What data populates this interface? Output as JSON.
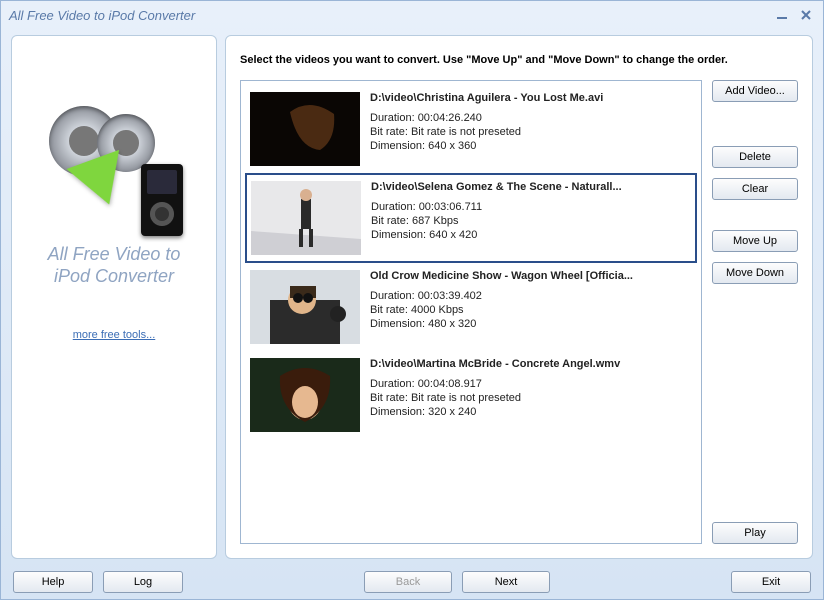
{
  "window": {
    "title": "All Free Video to iPod Converter"
  },
  "sidebar": {
    "appName1": "All Free Video to",
    "appName2": "iPod Converter",
    "moreTools": "more free tools..."
  },
  "main": {
    "instruction": "Select the videos you want to convert. Use \"Move Up\" and \"Move Down\" to change the order.",
    "videos": [
      {
        "title": "D:\\video\\Christina Aguilera - You Lost Me.avi",
        "duration": "Duration: 00:04:26.240",
        "bitrate": "Bit rate: Bit rate is not preseted",
        "dimension": "Dimension: 640 x 360",
        "selected": false
      },
      {
        "title": "D:\\video\\Selena Gomez & The Scene - Naturall...",
        "duration": "Duration: 00:03:06.711",
        "bitrate": "Bit rate: 687 Kbps",
        "dimension": "Dimension: 640 x 420",
        "selected": true
      },
      {
        "title": "Old Crow Medicine Show - Wagon Wheel [Officia...",
        "duration": "Duration: 00:03:39.402",
        "bitrate": "Bit rate: 4000 Kbps",
        "dimension": "Dimension: 480 x 320",
        "selected": false
      },
      {
        "title": "D:\\video\\Martina McBride - Concrete Angel.wmv",
        "duration": "Duration: 00:04:08.917",
        "bitrate": "Bit rate: Bit rate is not preseted",
        "dimension": "Dimension: 320 x 240",
        "selected": false
      }
    ],
    "buttons": {
      "addVideo": "Add Video...",
      "delete": "Delete",
      "clear": "Clear",
      "moveUp": "Move Up",
      "moveDown": "Move Down",
      "play": "Play"
    }
  },
  "footer": {
    "help": "Help",
    "log": "Log",
    "back": "Back",
    "next": "Next",
    "exit": "Exit"
  }
}
